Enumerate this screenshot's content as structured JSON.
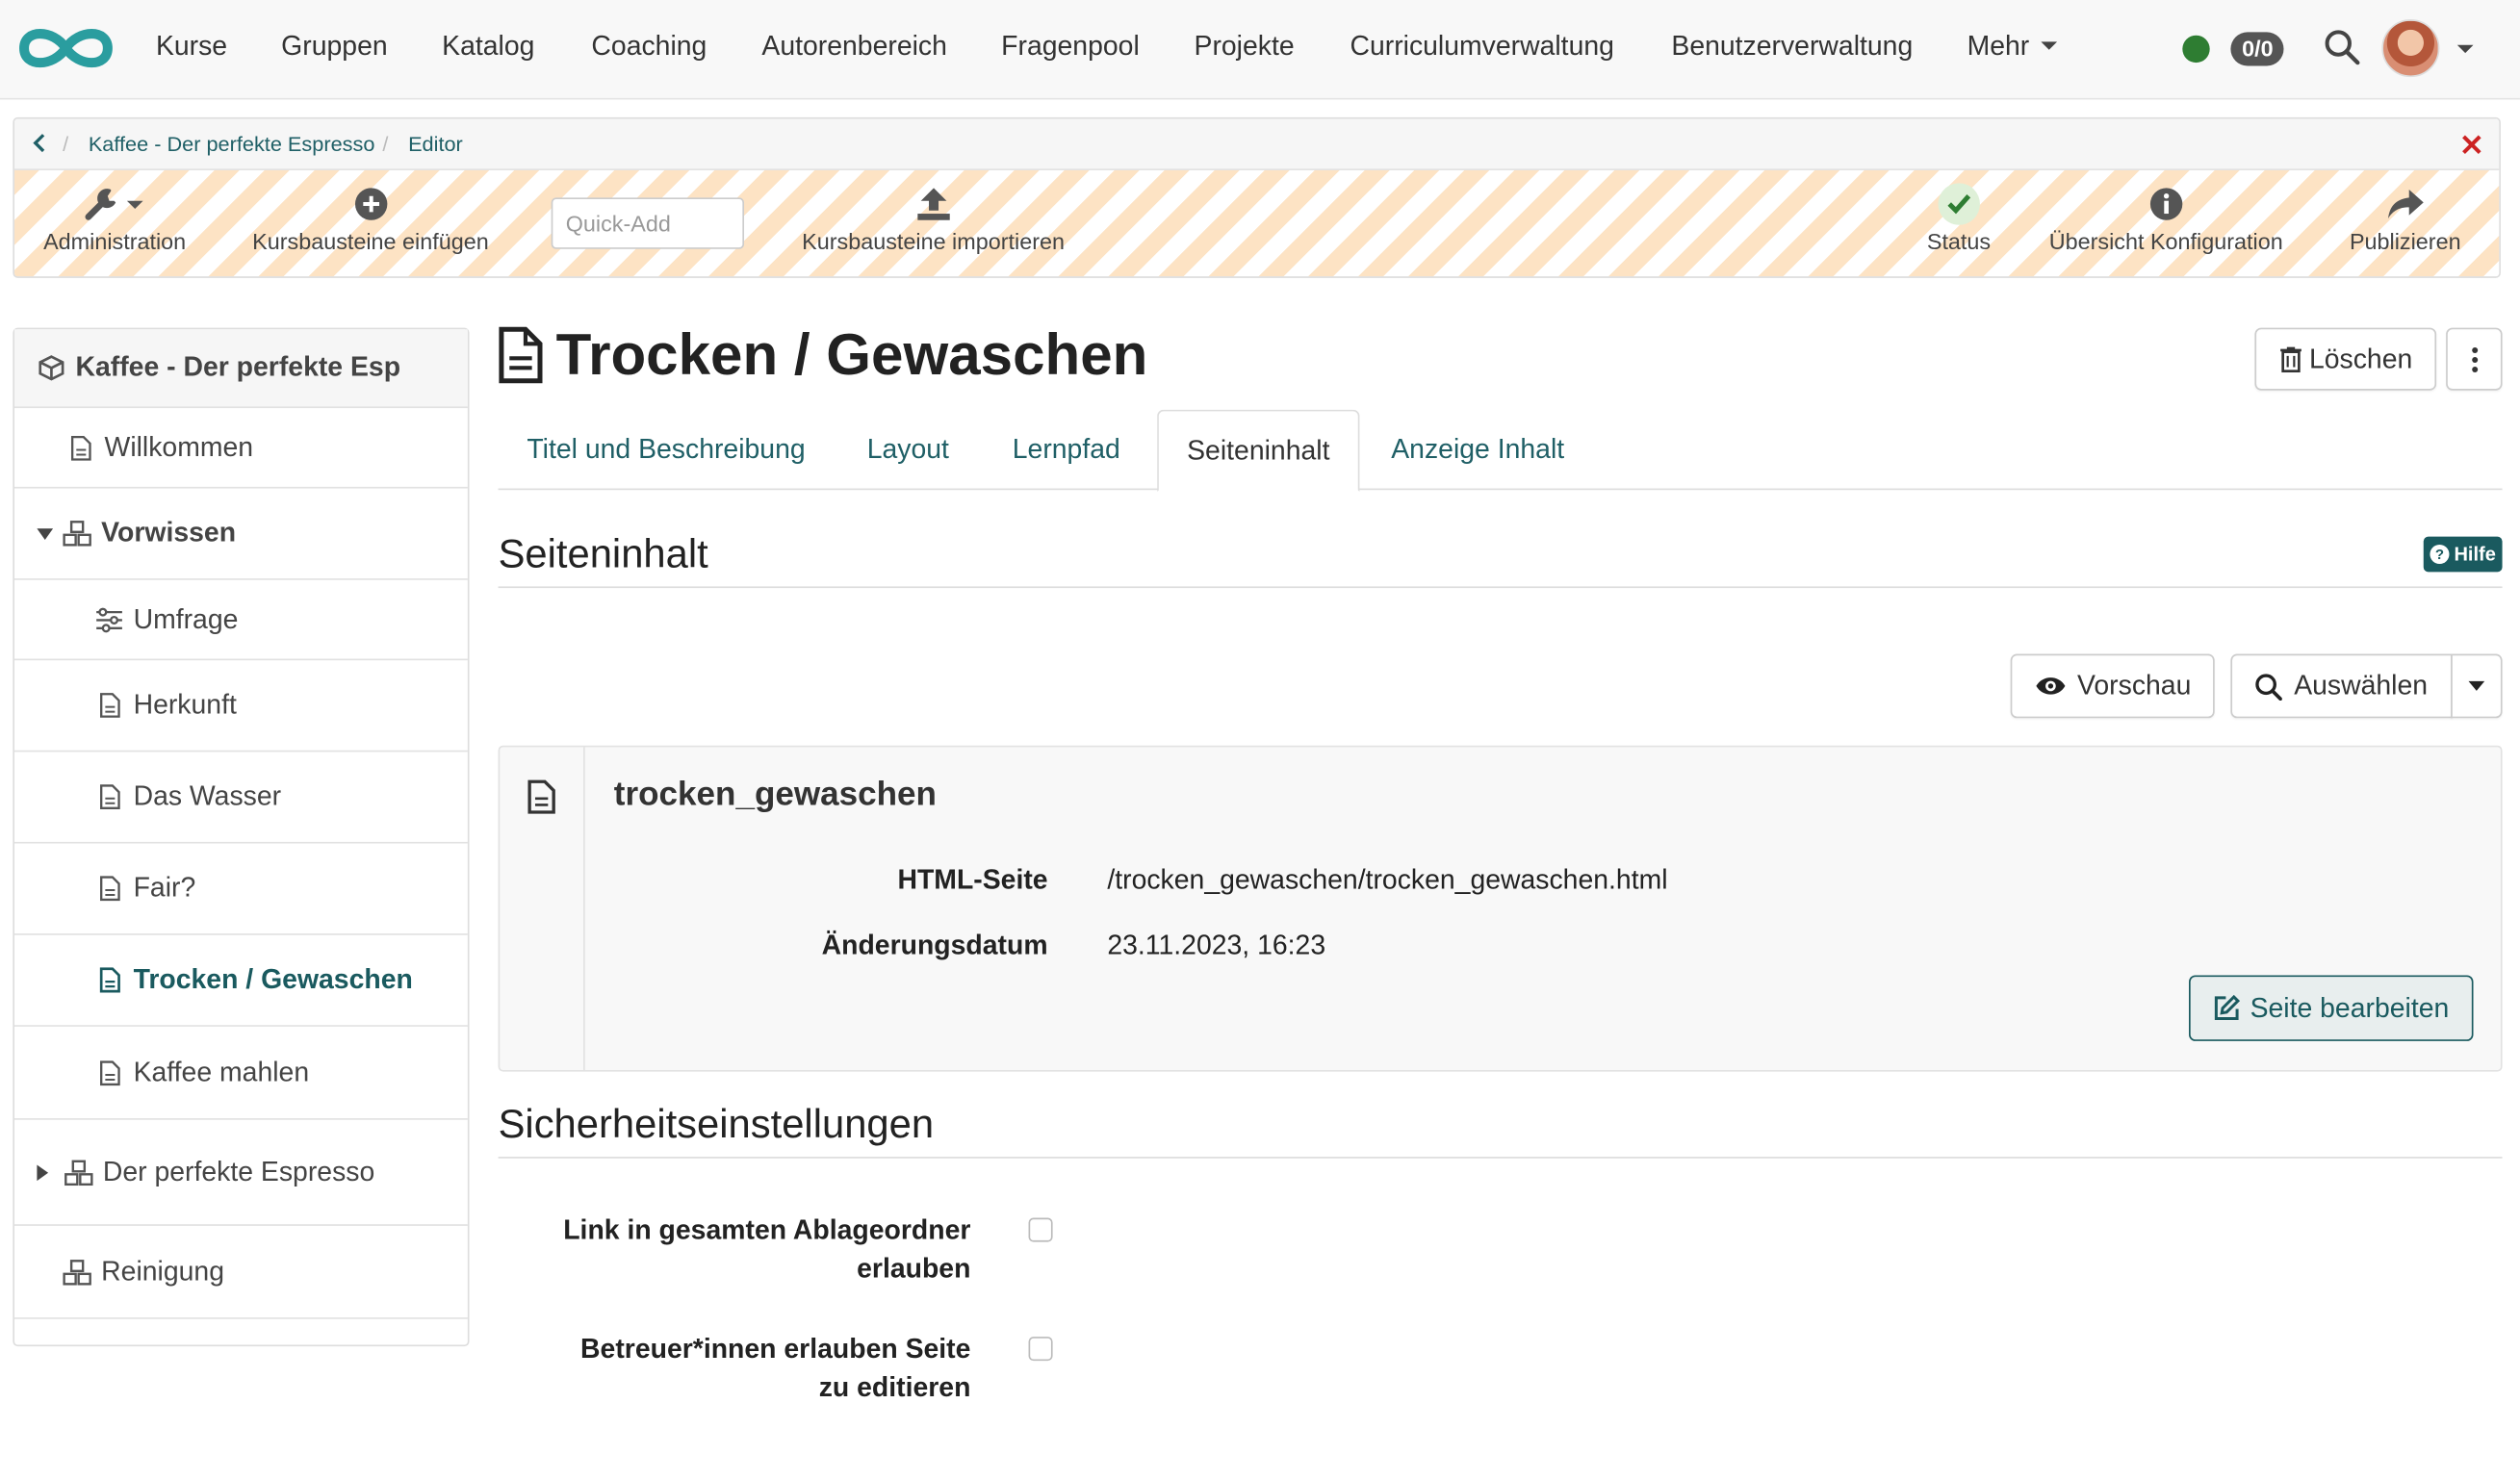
{
  "nav": {
    "items": [
      "Kurse",
      "Gruppen",
      "Katalog",
      "Coaching",
      "Autorenbereich",
      "Fragenpool",
      "Projekte",
      "Curriculumverwaltung",
      "Benutzerverwaltung",
      "Mehr"
    ],
    "badge": "0/0",
    "status_color": "#2e7d32"
  },
  "breadcrumb": {
    "course": "Kaffee - Der perfekte Espresso",
    "current": "Editor"
  },
  "toolbar": {
    "administration": "Administration",
    "insert": "Kursbausteine einfügen",
    "quickadd_placeholder": "Quick-Add",
    "import": "Kursbausteine importieren",
    "status": "Status",
    "overview": "Übersicht Konfiguration",
    "publish": "Publizieren"
  },
  "sidebar": {
    "root": "Kaffee - Der perfekte Esp",
    "items": [
      {
        "label": "Willkommen"
      },
      {
        "label": "Vorwissen"
      },
      {
        "label": "Umfrage"
      },
      {
        "label": "Herkunft"
      },
      {
        "label": "Das Wasser"
      },
      {
        "label": "Fair?"
      },
      {
        "label": "Trocken / Gewaschen"
      },
      {
        "label": "Kaffee mahlen"
      },
      {
        "label": "Der perfekte Espresso"
      },
      {
        "label": "Reinigung"
      }
    ]
  },
  "main": {
    "title": "Trocken / Gewaschen",
    "delete_label": "Löschen",
    "tabs": [
      "Titel und Beschreibung",
      "Layout",
      "Lernpfad",
      "Seiteninhalt",
      "Anzeige Inhalt"
    ],
    "section_content": "Seiteninhalt",
    "help": "Hilfe",
    "preview": "Vorschau",
    "select": "Auswählen",
    "file": {
      "name": "trocken_gewaschen",
      "html_label": "HTML-Seite",
      "html_value": "/trocken_gewaschen/trocken_gewaschen.html",
      "date_label": "Änderungsdatum",
      "date_value": "23.11.2023, 16:23",
      "edit_label": "Seite bearbeiten"
    },
    "section_security": "Sicherheitseinstellungen",
    "security": {
      "opt1": "Link in gesamten Ablageordner erlauben",
      "opt2": "Betreuer*innen erlauben Seite zu editieren"
    }
  },
  "colors": {
    "accent": "#1a5a5f",
    "stripe": "#fde3c4",
    "close": "#cc2222"
  }
}
